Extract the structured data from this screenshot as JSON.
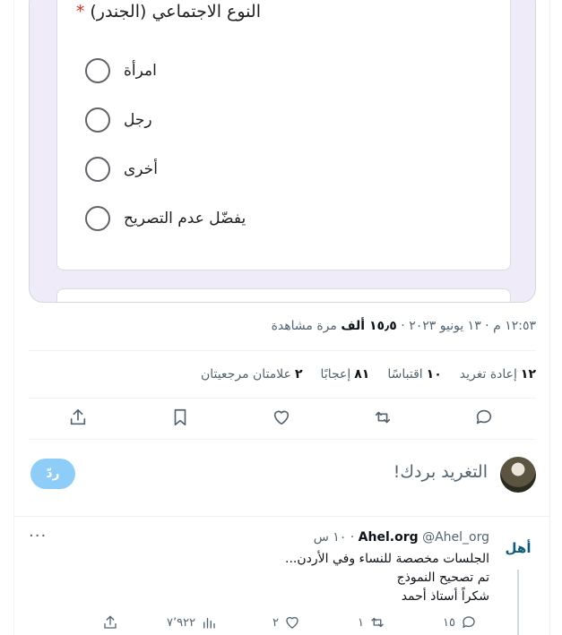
{
  "form": {
    "question_title": "النوع الاجتماعي (الجندر)",
    "required_mark": "*",
    "options": [
      "امرأة",
      "رجل",
      "أخرى",
      "يفضّل عدم التصريح"
    ]
  },
  "tweet_meta": {
    "time": "١٢:٥٣ م",
    "separator": "·",
    "date": "١٣ يونيو ٢٠٢٣",
    "views_count": "١٥٫٥ ألف",
    "views_label": "مرة مشاهدة"
  },
  "stats": [
    {
      "count": "١٢",
      "label": "إعادة تغريد"
    },
    {
      "count": "١٠",
      "label": "اقتباسًا"
    },
    {
      "count": "٨١",
      "label": "إعجابًا"
    },
    {
      "count": "٢",
      "label": "علامتان مرجعيتان"
    }
  ],
  "actions": {
    "reply": "reply-icon",
    "retweet": "retweet-icon",
    "like": "heart-icon",
    "bookmark": "bookmark-icon",
    "share": "share-icon"
  },
  "compose": {
    "placeholder": "التغريد بردك!",
    "button_label": "ردّ",
    "button_color": "#8ecdf8"
  },
  "reply_tweet": {
    "display_name": "Ahel.org",
    "handle": "@Ahel_org",
    "time_ago": "١٠ س",
    "avatar_text": "أهل",
    "lines": [
      "الجلسات مخصصة للنساء  وفي الأردن...",
      "تم تصحيح النموذج",
      "شكراً أستاذ أحمد"
    ],
    "replies": "١٥",
    "retweets": "١",
    "likes": "٢",
    "views": "٧٬٩٢٢",
    "more": "···"
  }
}
